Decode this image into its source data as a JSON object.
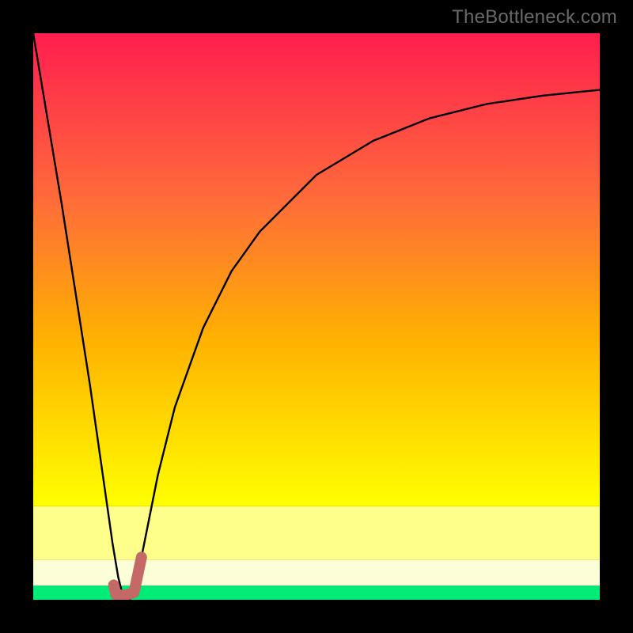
{
  "watermark": "TheBottleneck.com",
  "colors": {
    "curve_main": "#000000",
    "curve_highlight": "#c46868",
    "band_yellow_bright": "#feff8a",
    "band_yellow_pale": "#fbfed7",
    "band_green": "#00ec76",
    "grad_top": "#ff1e4f",
    "grad_mid": "#ffb200",
    "grad_low": "#ffff00"
  },
  "chart_data": {
    "type": "line",
    "title": "",
    "xlabel": "",
    "ylabel": "",
    "xlim": [
      0,
      100
    ],
    "ylim": [
      0,
      100
    ],
    "grid": false,
    "legend": false,
    "description": "Bottleneck percentage curve. 0 on the y-axis (bottom) is the optimal / no-bottleneck region (green). Higher y means worse bottleneck (red). The V-shaped curve drops to ~0 near x≈16 (the ideal match point, highlighted with a thick salmon J-mark), then rises asymptotically toward ~90 as x increases.",
    "series": [
      {
        "name": "bottleneck_curve",
        "x": [
          0,
          5,
          10,
          14,
          15,
          16,
          17,
          18,
          20,
          22,
          25,
          30,
          35,
          40,
          50,
          60,
          70,
          80,
          90,
          100
        ],
        "y": [
          100,
          70,
          38,
          10,
          4,
          0,
          0,
          2,
          12,
          22,
          34,
          48,
          58,
          65,
          75,
          81,
          85,
          87.5,
          89,
          90
        ]
      }
    ],
    "highlight_segment": {
      "name": "optimal_marker_J",
      "x": [
        14.2,
        14.6,
        16.2,
        17.8,
        19.1
      ],
      "y": [
        2.6,
        0.9,
        0.8,
        1.3,
        7.5
      ]
    },
    "background_bands": [
      {
        "name": "green_safe",
        "y_from": 0.0,
        "y_to": 2.5,
        "color": "#00ec76"
      },
      {
        "name": "yellow_pale",
        "y_from": 2.5,
        "y_to": 7.0,
        "color": "#fbfed7"
      },
      {
        "name": "yellow_bright",
        "y_from": 7.0,
        "y_to": 16.5,
        "color": "#feff8a"
      },
      {
        "name": "gradient_warm",
        "y_from": 16.5,
        "y_to": 100.0,
        "color": "gradient"
      }
    ]
  }
}
